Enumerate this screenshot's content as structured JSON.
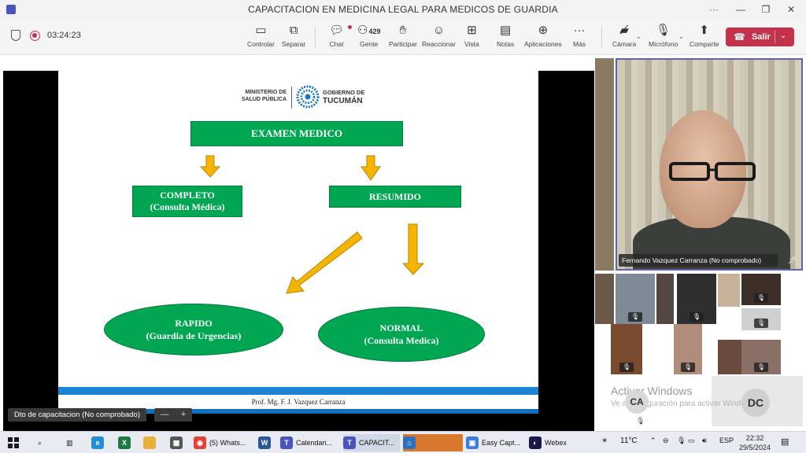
{
  "window": {
    "title": "CAPACITACION EN MEDICINA LEGAL PARA MEDICOS DE GUARDIA",
    "controls": [
      "···",
      "—",
      "❐",
      "✕"
    ]
  },
  "toolbar": {
    "timer": "03:24:23",
    "buttons": [
      {
        "label": "Controlar",
        "icon": "control-icon"
      },
      {
        "label": "Separar",
        "icon": "popout-icon"
      },
      {
        "label": "Chat",
        "icon": "chat-icon"
      },
      {
        "label": "Gente",
        "icon": "people-icon",
        "count": "429"
      },
      {
        "label": "Participar",
        "icon": "raise-hand-icon"
      },
      {
        "label": "Reaccionar",
        "icon": "react-icon"
      },
      {
        "label": "Vista",
        "icon": "view-icon"
      },
      {
        "label": "Notas",
        "icon": "notes-icon"
      },
      {
        "label": "Aplicaciones",
        "icon": "apps-icon"
      },
      {
        "label": "Más",
        "icon": "more-icon"
      },
      {
        "label": "Cámara",
        "icon": "camera-off-icon"
      },
      {
        "label": "Micrófono",
        "icon": "mic-off-icon"
      },
      {
        "label": "Comparte",
        "icon": "share-icon"
      }
    ],
    "leave_label": "Salir"
  },
  "slide": {
    "logo_left": "MINISTERIO DE\nSALUD PÚBLICA",
    "logo_right_top": "GOBIERNO DE",
    "logo_right_bottom": "TUCUMÁN",
    "examen": "EXAMEN MEDICO",
    "completo_1": "COMPLETO",
    "completo_2": "(Consulta Médica)",
    "resumido": "RESUMIDO",
    "rapido_1": "RAPIDO",
    "rapido_2": "(Guardia de Urgencias)",
    "normal_1": "NORMAL",
    "normal_2": "(Consulta Medica)",
    "footer": "Prof. Mg. F. J. Vazquez Carranza"
  },
  "share_label": "Dto de capacitacion (No comprobado)",
  "zoom_controls": [
    "—",
    "+"
  ],
  "participants": {
    "main_name": "Fernando Vazquez Carranza (No comprobado)",
    "activate_title": "Activar Windows",
    "activate_sub": "Ve a Configuración para activar Windows.",
    "avatar_ca": "CA",
    "avatar_dc": "DC"
  },
  "taskbar": {
    "items": [
      {
        "label": "(5) Whats...",
        "icon": "chrome-icon"
      },
      {
        "label": "Calendari...",
        "icon": "teams-icon"
      },
      {
        "label": "CAPACIT...",
        "icon": "teams-icon"
      },
      {
        "label": "Easy Capt...",
        "icon": "capture-icon"
      },
      {
        "label": "Webex",
        "icon": "webex-icon"
      }
    ],
    "weather": "11°C",
    "language": "ESP",
    "time": "22:32",
    "date": "29/5/2024"
  },
  "colors": {
    "accent": "#6264a7",
    "leave": "#c4314b",
    "slide_green": "#00a651",
    "arrow_yellow": "#f4b400"
  }
}
